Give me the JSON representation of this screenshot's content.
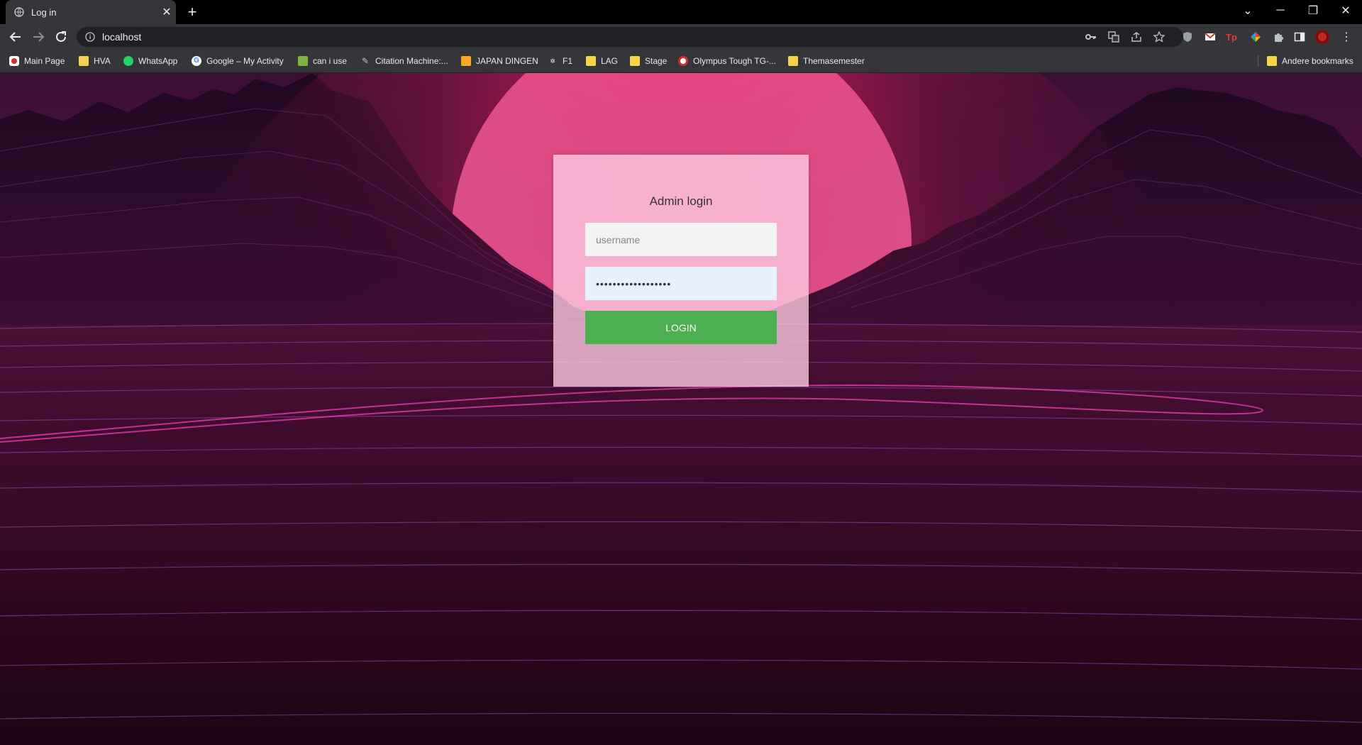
{
  "browser": {
    "tab_title": "Log in",
    "url": "localhost",
    "bookmarks": [
      {
        "label": "Main Page",
        "icon": "wiki-icon"
      },
      {
        "label": "HVA",
        "icon": "folder-icon"
      },
      {
        "label": "WhatsApp",
        "icon": "whatsapp-icon"
      },
      {
        "label": "Google – My Activity",
        "icon": "google-icon"
      },
      {
        "label": "can i use",
        "icon": "caniuse-icon"
      },
      {
        "label": "Citation Machine:...",
        "icon": "citation-icon"
      },
      {
        "label": "JAPAN DINGEN",
        "icon": "japan-icon"
      },
      {
        "label": "F1",
        "icon": "f1-icon"
      },
      {
        "label": "LAG",
        "icon": "folder-icon"
      },
      {
        "label": "Stage",
        "icon": "folder-icon"
      },
      {
        "label": "Olympus Tough TG-...",
        "icon": "olympus-icon"
      },
      {
        "label": "Themasemester",
        "icon": "folder-icon"
      }
    ],
    "other_bookmarks": "Andere bookmarks"
  },
  "login": {
    "title": "Admin login",
    "username_placeholder": "username",
    "password_value": "••••••••••••••••••",
    "button_label": "login"
  },
  "colors": {
    "button": "#4caf50",
    "sun": "#f36fa6",
    "password_autofill": "#e8f0fe"
  }
}
